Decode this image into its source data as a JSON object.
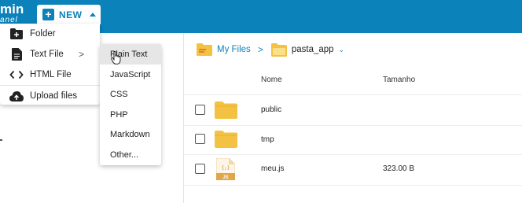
{
  "brand": {
    "title": "min",
    "subtitle": "anel"
  },
  "new_button": {
    "label": "NEW",
    "plus": "+"
  },
  "menu": {
    "items": [
      {
        "label": "Folder",
        "icon": "folder-plus-icon"
      },
      {
        "label": "Text File",
        "icon": "text-file-icon",
        "arrow": ">"
      },
      {
        "label": "HTML File",
        "icon": "code-icon"
      },
      {
        "label": "Upload files",
        "icon": "cloud-upload-icon"
      }
    ]
  },
  "submenu": {
    "items": [
      {
        "label": "Plain Text"
      },
      {
        "label": "JavaScript"
      },
      {
        "label": "CSS"
      },
      {
        "label": "PHP"
      },
      {
        "label": "Markdown"
      },
      {
        "label": "Other..."
      }
    ]
  },
  "breadcrumb": {
    "root": "My Files",
    "separator": ">",
    "current": "pasta_app"
  },
  "table": {
    "headers": {
      "name": "Nome",
      "size": "Tamanho"
    },
    "rows": [
      {
        "name": "public",
        "size": "",
        "type": "folder"
      },
      {
        "name": "tmp",
        "size": "",
        "type": "folder"
      },
      {
        "name": "meu.js",
        "size": "323.00 B",
        "type": "js-file",
        "badge": "JS",
        "glyph": "{;}"
      }
    ]
  },
  "colors": {
    "accent": "#0b82b9",
    "folder": "#f4c242",
    "js_file": "#e0a64a"
  }
}
